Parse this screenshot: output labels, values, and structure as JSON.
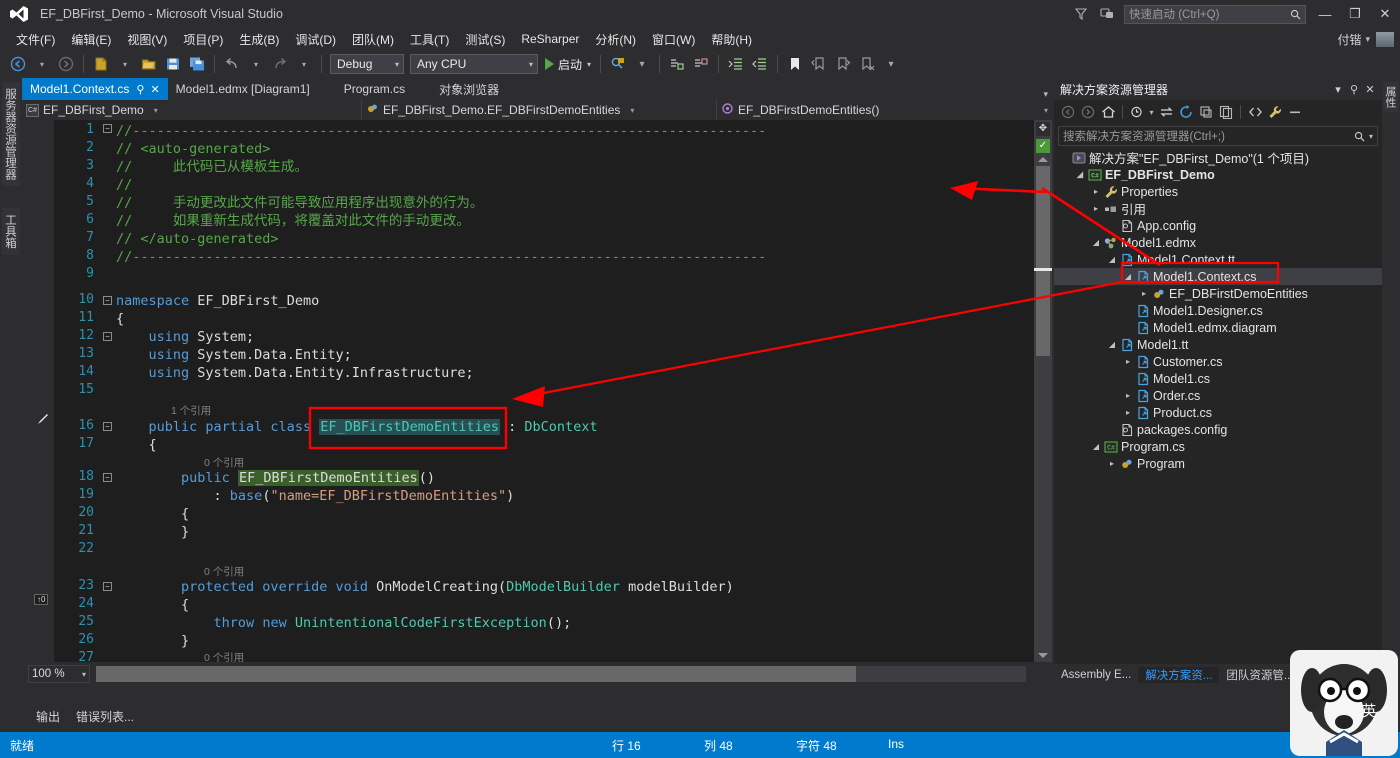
{
  "window": {
    "title": "EF_DBFirst_Demo - Microsoft Visual Studio",
    "logo_icon": "visual-studio-logo-icon",
    "quick_launch_placeholder": "快速启动 (Ctrl+Q)",
    "quick_launch_value": "",
    "search_icon": "search-icon",
    "feedback_icon": "feedback-smiley-icon",
    "notification_icon": "notification-flag-icon",
    "minimize_label": "—",
    "restore_label": "❐",
    "close_label": "✕",
    "account_name": "付锴",
    "account_caret": "▾"
  },
  "menubar": {
    "items": [
      {
        "label": "文件(F)"
      },
      {
        "label": "编辑(E)"
      },
      {
        "label": "视图(V)"
      },
      {
        "label": "项目(P)"
      },
      {
        "label": "生成(B)"
      },
      {
        "label": "调试(D)"
      },
      {
        "label": "团队(M)"
      },
      {
        "label": "工具(T)"
      },
      {
        "label": "测试(S)"
      },
      {
        "label": "ReSharper"
      },
      {
        "label": "分析(N)"
      },
      {
        "label": "窗口(W)"
      },
      {
        "label": "帮助(H)"
      }
    ]
  },
  "toolbar": {
    "nav_back_icon": "navigate-back-icon",
    "nav_forward_icon": "navigate-forward-icon",
    "new_project_icon": "new-project-icon",
    "open_file_icon": "open-file-icon",
    "save_icon": "save-icon",
    "save_all_icon": "save-all-icon",
    "undo_icon": "undo-icon",
    "redo_icon": "redo-icon",
    "config_value": "Debug",
    "platform_value": "Any CPU",
    "start_label": "启动",
    "start_icon": "play-triangle-icon",
    "find_icon": "find-in-files-icon",
    "comment_icon": "comment-selection-icon",
    "uncomment_icon": "uncomment-selection-icon",
    "indent_icon": "increase-indent-icon",
    "outdent_icon": "decrease-indent-icon",
    "bookmark_icon": "bookmark-icon",
    "prev_bookmark_icon": "previous-bookmark-icon",
    "next_bookmark_icon": "next-bookmark-icon",
    "clear_bookmark_icon": "clear-bookmarks-icon",
    "overflow_icon": "toolbar-overflow-icon"
  },
  "left_dock": {
    "tabs": [
      {
        "label": "服务器资源管理器"
      },
      {
        "label": "工具箱"
      }
    ]
  },
  "editor": {
    "tabs": [
      {
        "label": "Model1.Context.cs",
        "active": true,
        "pin_icon": "pin-icon",
        "close_icon": "close-icon"
      },
      {
        "label": "Model1.edmx [Diagram1]",
        "active": false
      },
      {
        "label": "Program.cs",
        "active": false
      },
      {
        "label": "对象浏览器",
        "active": false
      }
    ],
    "navbar": {
      "project": "EF_DBFirst_Demo",
      "project_icon": "csharp-project-icon",
      "type": "EF_DBFirst_Demo.EF_DBFirstDemoEntities",
      "type_icon": "class-icon",
      "member": "EF_DBFirstDemoEntities()",
      "member_icon": "method-icon",
      "caret": "▾"
    },
    "zoom_level": "100 %",
    "zoom_caret": "▾",
    "codelens": {
      "one_ref": "1 个引用",
      "zero_ref": "0 个引用"
    },
    "lines": [
      {
        "n": 1,
        "text": "//------------------------------------------------------------------------------"
      },
      {
        "n": 2,
        "text": "// <auto-generated>"
      },
      {
        "n": 3,
        "text": "//     此代码已从模板生成。"
      },
      {
        "n": 4,
        "text": "//"
      },
      {
        "n": 5,
        "text": "//     手动更改此文件可能导致应用程序出现意外的行为。"
      },
      {
        "n": 6,
        "text": "//     如果重新生成代码，将覆盖对此文件的手动更改。"
      },
      {
        "n": 7,
        "text": "// </auto-generated>"
      },
      {
        "n": 8,
        "text": "//------------------------------------------------------------------------------"
      },
      {
        "n": 9,
        "text": ""
      },
      {
        "n": 10,
        "text": "namespace EF_DBFirst_Demo"
      },
      {
        "n": 11,
        "text": "{"
      },
      {
        "n": 12,
        "text": "    using System;"
      },
      {
        "n": 13,
        "text": "    using System.Data.Entity;"
      },
      {
        "n": 14,
        "text": "    using System.Data.Entity.Infrastructure;"
      },
      {
        "n": 15,
        "text": ""
      },
      {
        "n": 16,
        "text": "    public partial class EF_DBFirstDemoEntities : DbContext"
      },
      {
        "n": 17,
        "text": "    {"
      },
      {
        "n": 18,
        "text": "        public EF_DBFirstDemoEntities()"
      },
      {
        "n": 19,
        "text": "            : base(\"name=EF_DBFirstDemoEntities\")"
      },
      {
        "n": 20,
        "text": "        {"
      },
      {
        "n": 21,
        "text": "        }"
      },
      {
        "n": 22,
        "text": ""
      },
      {
        "n": 23,
        "text": "        protected override void OnModelCreating(DbModelBuilder modelBuilder)"
      },
      {
        "n": 24,
        "text": "        {"
      },
      {
        "n": 25,
        "text": "            throw new UnintentionalCodeFirstException();"
      },
      {
        "n": 26,
        "text": "        }"
      },
      {
        "n": 27,
        "text": ""
      }
    ],
    "selected_token": "EF_DBFirstDemoEntities",
    "scroll": {
      "split_icon": "split-view-icon",
      "health_icon": "no-issues-checkmark-icon",
      "up_icon": "scroll-up-icon",
      "down_icon": "scroll-down-icon"
    }
  },
  "bottom_tabs": [
    {
      "label": "输出"
    },
    {
      "label": "错误列表..."
    }
  ],
  "solution_explorer": {
    "title": "解决方案资源管理器",
    "title_caret_icon": "chevron-down-icon",
    "pin_icon": "pin-icon",
    "close_icon": "close-icon",
    "toolbar": {
      "back_icon": "navigate-back-icon",
      "forward_icon": "navigate-forward-icon",
      "home_icon": "home-icon",
      "pending_changes_icon": "pending-changes-icon",
      "sync_icon": "sync-with-active-document-icon",
      "refresh_icon": "refresh-icon",
      "collapse_icon": "collapse-all-icon",
      "show_all_icon": "show-all-files-icon",
      "code_icon": "view-code-icon",
      "properties_icon": "properties-wrench-icon",
      "hide_icon": "hide-pane-icon"
    },
    "search_placeholder": "搜索解决方案资源管理器(Ctrl+;)",
    "search_icon": "search-icon",
    "search_caret_icon": "chevron-down-icon",
    "tree": [
      {
        "label": "解决方案\"EF_DBFirst_Demo\"(1 个项目)",
        "indent": 0,
        "twist": "",
        "icon": "solution-icon",
        "bold": false,
        "selected": false
      },
      {
        "label": "EF_DBFirst_Demo",
        "indent": 1,
        "twist": "▲",
        "icon": "csharp-project-icon",
        "bold": true,
        "selected": false
      },
      {
        "label": "Properties",
        "indent": 2,
        "twist": "▶",
        "icon": "properties-wrench-icon",
        "bold": false,
        "selected": false
      },
      {
        "label": "引用",
        "indent": 2,
        "twist": "▶",
        "icon": "references-icon",
        "bold": false,
        "selected": false
      },
      {
        "label": "App.config",
        "indent": 3,
        "twist": "",
        "icon": "config-file-icon",
        "bold": false,
        "selected": false
      },
      {
        "label": "Model1.edmx",
        "indent": 2,
        "twist": "▲",
        "icon": "edmx-model-icon",
        "bold": false,
        "selected": false
      },
      {
        "label": "Model1.Context.tt",
        "indent": 3,
        "twist": "▲",
        "icon": "tt-template-icon",
        "bold": false,
        "selected": false
      },
      {
        "label": "Model1.Context.cs",
        "indent": 4,
        "twist": "▲",
        "icon": "csharp-file-icon",
        "bold": false,
        "selected": true
      },
      {
        "label": "EF_DBFirstDemoEntities",
        "indent": 5,
        "twist": "▶",
        "icon": "class-icon",
        "bold": false,
        "selected": false
      },
      {
        "label": "Model1.Designer.cs",
        "indent": 4,
        "twist": "",
        "icon": "csharp-file-icon",
        "bold": false,
        "selected": false
      },
      {
        "label": "Model1.edmx.diagram",
        "indent": 4,
        "twist": "",
        "icon": "csharp-file-icon",
        "bold": false,
        "selected": false
      },
      {
        "label": "Model1.tt",
        "indent": 3,
        "twist": "▲",
        "icon": "tt-template-icon",
        "bold": false,
        "selected": false
      },
      {
        "label": "Customer.cs",
        "indent": 4,
        "twist": "▶",
        "icon": "csharp-file-icon",
        "bold": false,
        "selected": false
      },
      {
        "label": "Model1.cs",
        "indent": 4,
        "twist": "",
        "icon": "csharp-file-icon",
        "bold": false,
        "selected": false
      },
      {
        "label": "Order.cs",
        "indent": 4,
        "twist": "▶",
        "icon": "csharp-file-icon",
        "bold": false,
        "selected": false
      },
      {
        "label": "Product.cs",
        "indent": 4,
        "twist": "▶",
        "icon": "csharp-file-icon",
        "bold": false,
        "selected": false
      },
      {
        "label": "packages.config",
        "indent": 3,
        "twist": "",
        "icon": "config-file-icon",
        "bold": false,
        "selected": false
      },
      {
        "label": "Program.cs",
        "indent": 2,
        "twist": "▲",
        "icon": "csharp-project-icon",
        "bold": false,
        "selected": false
      },
      {
        "label": "Program",
        "indent": 3,
        "twist": "▶",
        "icon": "class-icon",
        "bold": false,
        "selected": false
      }
    ],
    "footer_tabs": [
      {
        "label": "Assembly E...",
        "active": false
      },
      {
        "label": "解决方案资...",
        "active": true
      },
      {
        "label": "团队资源管...",
        "active": false
      }
    ]
  },
  "right_dock": {
    "tabs": [
      {
        "label": "属性"
      }
    ]
  },
  "statusbar": {
    "ready": "就绪",
    "line": "行 16",
    "column": "列 48",
    "chars": "字符 48",
    "insert_mode": "Ins"
  },
  "overlay": {
    "ime_label": "英",
    "dog_icon": "dog-avatar-icon",
    "annotation_color": "#ff0000"
  }
}
